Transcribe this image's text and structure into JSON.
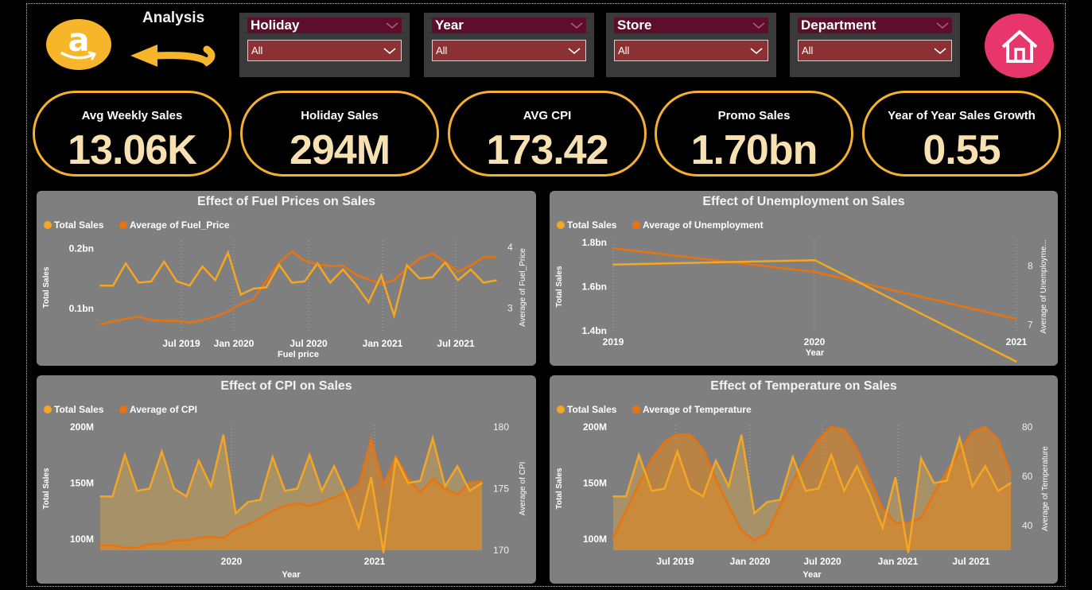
{
  "header": {
    "logo_letter": "a",
    "analysis_label": "Analysis"
  },
  "slicers": [
    {
      "title": "Holiday",
      "value": "All"
    },
    {
      "title": "Year",
      "value": "All"
    },
    {
      "title": "Store",
      "value": "All"
    },
    {
      "title": "Department",
      "value": "All"
    }
  ],
  "kpis": [
    {
      "label": "Avg Weekly Sales",
      "value": "13.06K"
    },
    {
      "label": "Holiday Sales",
      "value": "294M"
    },
    {
      "label": "AVG CPI",
      "value": "173.42"
    },
    {
      "label": "Promo Sales",
      "value": "1.70bn"
    },
    {
      "label": "Year of Year Sales Growth",
      "value": "0.55"
    }
  ],
  "colors": {
    "total_sales": "#f5a623",
    "secondary": "#e8730f",
    "panel_bg": "#7f7f7f",
    "kpi_border": "#f5b02f",
    "slicer_head": "#5c0e2a",
    "slicer_box": "#8c3133",
    "home_button": "#e8356b"
  },
  "chart_data": [
    {
      "title": "Effect of Fuel Prices on Sales",
      "type": "line",
      "legend": [
        "Total Sales",
        "Average of Fuel_Price"
      ],
      "legend_position": "top-left",
      "xlabel": "Fuel price",
      "ylabel": "Total Sales",
      "y2label": "Average of Fuel_Price",
      "x_ticks": [
        "Jul 2019",
        "Jan 2020",
        "Jul 2020",
        "Jan 2021",
        "Jul 2021"
      ],
      "y_ticks": [
        "0.1bn",
        "0.2bn"
      ],
      "y2_ticks": [
        "3",
        "4"
      ],
      "ylim": [
        0.06,
        0.21
      ],
      "y2lim": [
        2.6,
        4.08
      ],
      "series": [
        {
          "name": "Total Sales",
          "axis": "left",
          "values": [
            0.138,
            0.138,
            0.175,
            0.143,
            0.145,
            0.178,
            0.145,
            0.138,
            0.17,
            0.147,
            0.193,
            0.123,
            0.133,
            0.135,
            0.173,
            0.143,
            0.145,
            0.175,
            0.143,
            0.165,
            0.14,
            0.11,
            0.155,
            0.088,
            0.172,
            0.15,
            0.152,
            0.177,
            0.147,
            0.165,
            0.143,
            0.147
          ]
        },
        {
          "name": "Average of Fuel_Price",
          "axis": "right",
          "values": [
            2.73,
            2.78,
            2.82,
            2.86,
            2.8,
            2.79,
            2.79,
            2.76,
            2.8,
            2.86,
            2.94,
            3.07,
            3.15,
            3.45,
            3.75,
            3.93,
            3.78,
            3.72,
            3.69,
            3.7,
            3.55,
            3.47,
            3.4,
            3.46,
            3.65,
            3.82,
            3.9,
            3.76,
            3.6,
            3.7,
            3.84,
            3.84
          ]
        }
      ]
    },
    {
      "title": "Effect of Unemployment on Sales",
      "type": "line",
      "legend": [
        "Total Sales",
        "Average of Unemployment"
      ],
      "legend_position": "top-left",
      "xlabel": "Year",
      "ylabel": "Total Sales",
      "y2label": "Average of Unemployme...",
      "x_ticks": [
        "2019",
        "2020",
        "2021"
      ],
      "y_ticks": [
        "1.4bn",
        "1.6bn",
        "1.8bn"
      ],
      "y2_ticks": [
        "7",
        "8"
      ],
      "ylim": [
        1.4,
        1.8
      ],
      "y2lim": [
        6.9,
        8.4
      ],
      "series": [
        {
          "name": "Total Sales",
          "axis": "left",
          "values": [
            1.7,
            1.72,
            1.26
          ]
        },
        {
          "name": "Average of Unemployment",
          "axis": "right",
          "values": [
            8.3,
            7.9,
            7.1
          ]
        }
      ]
    },
    {
      "title": "Effect of CPI on Sales",
      "type": "area",
      "legend": [
        "Total Sales",
        "Average of CPI"
      ],
      "legend_position": "top-left",
      "xlabel": "Year",
      "ylabel": "Total Sales",
      "y2label": "Average of CPI",
      "x_ticks": [
        "2020",
        "2021"
      ],
      "y_ticks": [
        "100M",
        "150M",
        "200M"
      ],
      "y2_ticks": [
        "170",
        "175",
        "180"
      ],
      "ylim": [
        90,
        200
      ],
      "y2lim": [
        170,
        180
      ],
      "series": [
        {
          "name": "Total Sales",
          "axis": "left",
          "values": [
            138,
            138,
            175,
            143,
            145,
            178,
            145,
            138,
            170,
            147,
            193,
            123,
            133,
            135,
            173,
            143,
            145,
            175,
            143,
            165,
            140,
            110,
            155,
            88,
            172,
            150,
            152,
            190,
            147,
            165,
            143,
            150
          ]
        },
        {
          "name": "Average of CPI",
          "axis": "right",
          "values": [
            170.4,
            170.4,
            170.2,
            170.2,
            170.5,
            170.5,
            170.8,
            170.8,
            171.0,
            171.1,
            171.0,
            171.7,
            172.1,
            172.6,
            173.2,
            173.6,
            173.8,
            173.6,
            173.9,
            174.3,
            174.7,
            175.3,
            179.0,
            175.3,
            177.6,
            175.8,
            174.7,
            175.8,
            175.0,
            174.5,
            175.5,
            175.6
          ]
        }
      ]
    },
    {
      "title": "Effect of Temperature on Sales",
      "type": "area",
      "legend": [
        "Total Sales",
        "Average of Temperature"
      ],
      "legend_position": "top-left",
      "xlabel": "Year",
      "ylabel": "Total Sales",
      "y2label": "Average of Temperature",
      "x_ticks": [
        "Jul 2019",
        "Jan 2020",
        "Jul 2020",
        "Jan 2021",
        "Jul 2021"
      ],
      "y_ticks": [
        "100M",
        "150M",
        "200M"
      ],
      "y2_ticks": [
        "40",
        "60",
        "80"
      ],
      "ylim": [
        90,
        200
      ],
      "y2lim": [
        30,
        80
      ],
      "series": [
        {
          "name": "Total Sales",
          "axis": "left",
          "values": [
            138,
            138,
            175,
            143,
            145,
            178,
            145,
            138,
            170,
            147,
            193,
            123,
            133,
            135,
            173,
            143,
            145,
            175,
            143,
            165,
            140,
            110,
            155,
            88,
            172,
            150,
            152,
            190,
            147,
            165,
            143,
            150
          ]
        },
        {
          "name": "Average of Temperature",
          "axis": "right",
          "values": [
            35,
            46,
            57,
            67,
            74,
            77,
            77,
            71,
            59,
            48,
            38,
            34,
            37,
            48,
            58,
            67,
            75,
            80,
            79,
            71,
            59,
            47,
            41,
            41,
            43,
            53,
            62,
            70,
            78,
            80,
            75,
            61
          ]
        }
      ]
    }
  ]
}
